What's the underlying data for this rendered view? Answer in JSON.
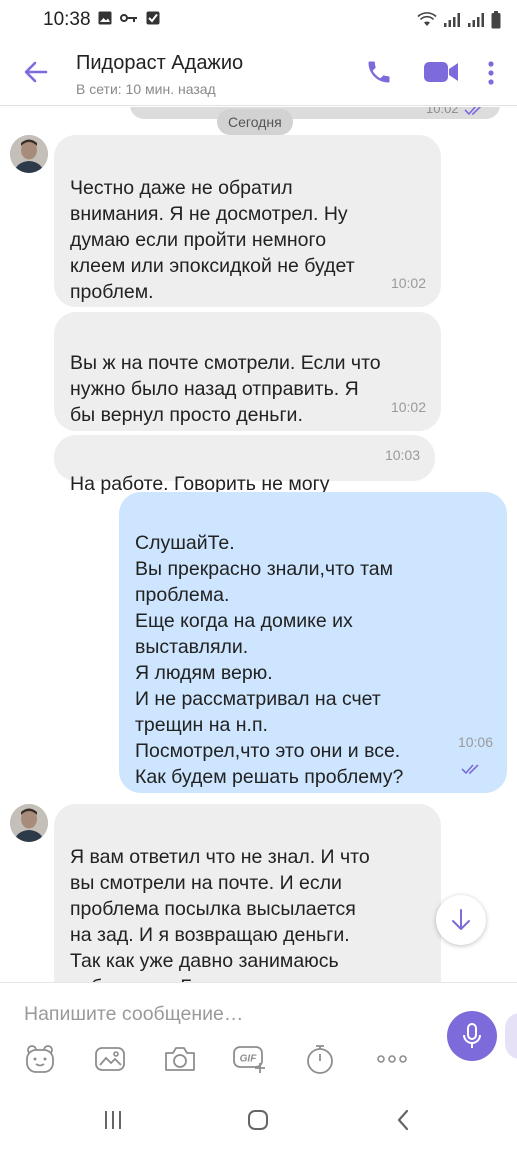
{
  "status_bar": {
    "time": "10:38",
    "left_icons": [
      "gallery-icon",
      "vpn-key-icon",
      "checkbox-icon"
    ],
    "right_icons": [
      "wifi-icon",
      "signal-icon",
      "signal-icon",
      "battery-icon"
    ]
  },
  "header": {
    "contact_name": "Пидораст Адажио",
    "contact_status": "В сети: 10 мин. назад"
  },
  "chat": {
    "previous_time": "10:02",
    "date_chip": "Сегодня",
    "messages": [
      {
        "direction": "in",
        "text": "Честно даже не обратил\nвнимания. Я не досмотрел. Ну\nдумаю если пройти немного\nклеем или эпоксидкой не будет\nпроблем.",
        "time": "10:02"
      },
      {
        "direction": "in",
        "text": "Вы ж на почте смотрели. Если что\nнужно было назад отправить. Я\nбы вернул просто деньги.",
        "time": "10:02"
      },
      {
        "direction": "in",
        "text": "На работе. Говорить не могу",
        "time": "10:03"
      },
      {
        "direction": "out",
        "text": "СлушайТе.\nВы прекрасно знали,что там\nпроблема.\nЕще когда на домике их\nвыставляли.\nЯ людям верю.\nИ не рассматривал на счет\nтрещин на н.п.\nПосмотрел,что это они и все.\nКак будем решать проблему?",
        "time": "10:06"
      },
      {
        "direction": "in",
        "text": "Я вам ответил что не знал. И что\nвы смотрели на почте. И если\nпроблема посылка высылается\nна зад. И я возвращаю деньги.\nТак как уже давно занимаюсь\nвоблерами. Были такие ситуации.\nНе люди при осмотре",
        "time": ""
      }
    ]
  },
  "composer": {
    "placeholder": "Напишите сообщение…",
    "tools": [
      "sticker-icon",
      "gallery-icon",
      "camera-icon",
      "gif-icon",
      "timer-icon",
      "more-icon"
    ]
  },
  "colors": {
    "accent": "#7d6bdc",
    "incoming_bubble": "#eeeeee",
    "outgoing_bubble": "#cde5fe",
    "read_check": "#7d6bdc"
  }
}
